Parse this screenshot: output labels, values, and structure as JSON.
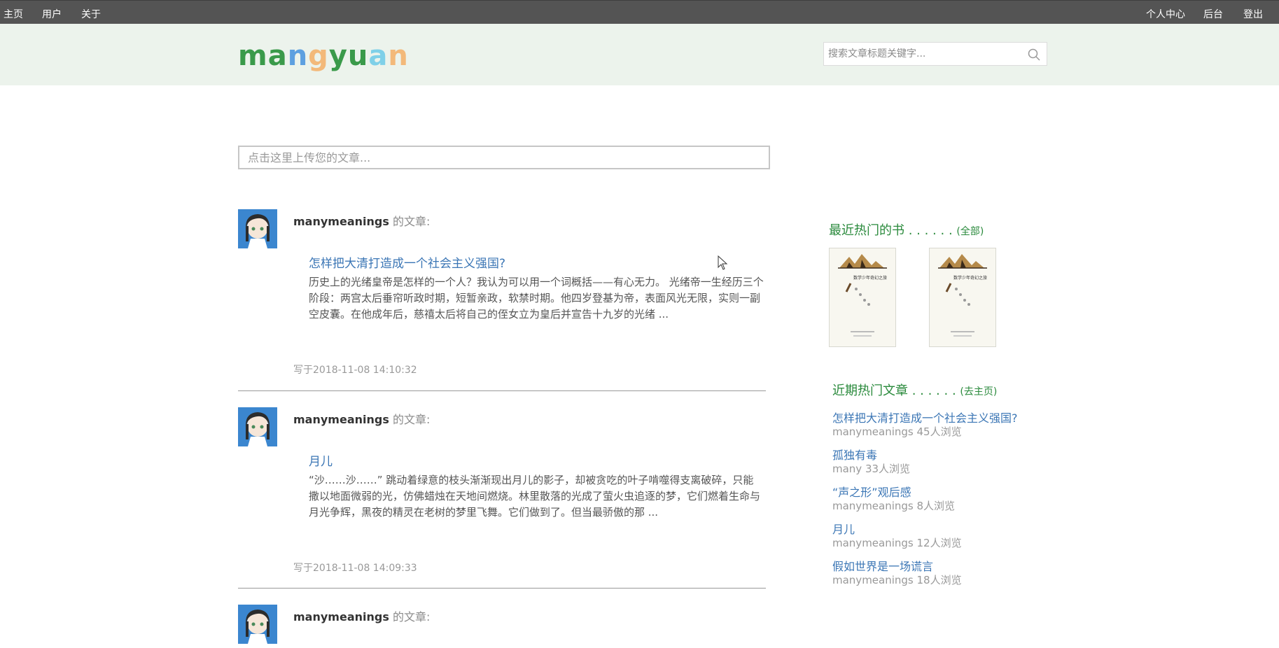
{
  "nav": {
    "left": [
      "主页",
      "用户",
      "关于"
    ],
    "right": [
      "个人中心",
      "后台",
      "登出"
    ]
  },
  "logo": {
    "letters": [
      "m",
      "a",
      "n",
      "g",
      "y",
      "u",
      "a",
      "n"
    ],
    "colors": [
      "#3a9a4a",
      "#3a9a4a",
      "#5da0e0",
      "#f3b97a",
      "#3a9a4a",
      "#3a9a4a",
      "#7fd0e8",
      "#f3b97a"
    ]
  },
  "search": {
    "placeholder": "搜索文章标题关键字..."
  },
  "upload": {
    "placeholder": "点击这里上传您的文章..."
  },
  "posts": [
    {
      "author": "manymeanings",
      "suffix": "的文章:",
      "title": "怎样把大清打造成一个社会主义强国?",
      "excerpt": "历史上的光绪皇帝是怎样的一个人？我认为可以用一个词概括——有心无力。 光绪帝一生经历三个阶段：两宫太后垂帘听政时期，短暂亲政，软禁时期。他四岁登基为帝，表面风光无限，实则一副空皮囊。在他成年后，慈禧太后将自己的侄女立为皇后并宣告十九岁的光绪 ...",
      "date": "写于2018-11-08 14:10:32"
    },
    {
      "author": "manymeanings",
      "suffix": "的文章:",
      "title": "月儿",
      "excerpt": "“沙……沙……” 跳动着绿意的枝头渐渐现出月儿的影子，却被贪吃的叶子啃噬得支离破碎，只能撒以地面微弱的光，仿佛蜡烛在天地间燃烧。林里散落的光成了萤火虫追逐的梦，它们燃着生命与月光争辉，黑夜的精灵在老树的梦里飞舞。它们做到了。但当最骄傲的那 ...",
      "date": "写于2018-11-08 14:09:33"
    },
    {
      "author": "manymeanings",
      "suffix": "的文章:"
    }
  ],
  "sidebar": {
    "books_heading": "最近热门的书 . . . . . .",
    "books_link": "(全部)",
    "articles_heading": "近期热门文章 . . . . . .",
    "articles_link": "(去主页)",
    "hot_articles": [
      {
        "title": "怎样把大清打造成一个社会主义强国?",
        "meta": "manymeanings 45人浏览"
      },
      {
        "title": "孤独有毒",
        "meta": "many 33人浏览"
      },
      {
        "title": "“声之形”观后感",
        "meta": "manymeanings 8人浏览"
      },
      {
        "title": "月儿",
        "meta": "manymeanings 12人浏览"
      },
      {
        "title": "假如世界是一场谎言",
        "meta": "manymeanings 18人浏览"
      }
    ]
  }
}
